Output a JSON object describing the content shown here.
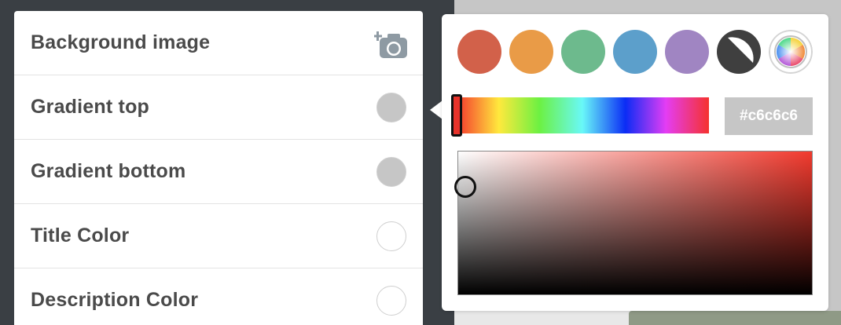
{
  "settings": {
    "rows": [
      {
        "label": "Background image",
        "control": "camera-plus-icon"
      },
      {
        "label": "Gradient top",
        "color": "#c6c6c6"
      },
      {
        "label": "Gradient bottom",
        "color": "#c6c6c6"
      },
      {
        "label": "Title Color",
        "color": "#ffffff"
      },
      {
        "label": "Description Color",
        "color": "#ffffff"
      }
    ]
  },
  "color_picker": {
    "presets": [
      {
        "name": "red",
        "color": "#d2614a"
      },
      {
        "name": "orange",
        "color": "#e99b47"
      },
      {
        "name": "green",
        "color": "#6dba8d"
      },
      {
        "name": "blue",
        "color": "#5c9fcb"
      },
      {
        "name": "purple",
        "color": "#a085c2"
      },
      {
        "name": "black-white",
        "color": "#3f3f3f"
      },
      {
        "name": "custom-rainbow",
        "color": "rainbow"
      }
    ],
    "hex_value": "#c6c6c6",
    "hue_value": 0
  }
}
